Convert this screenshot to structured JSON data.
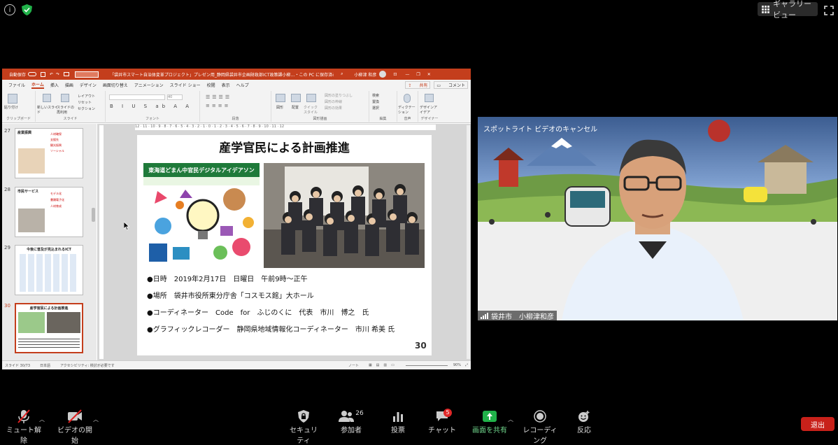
{
  "top": {
    "gallery_label": "ギャラリー ビュー"
  },
  "ppt": {
    "autosave": "自動保存",
    "doc_title": "「袋井市スマート自治体変革プロジェクト」プレゼン用_静岡県袋井市企画財政部ICT政策課小柳…・この PC に保存済み",
    "user": "小柳津 和彦",
    "tabs": [
      "ファイル",
      "ホーム",
      "挿入",
      "描画",
      "デザイン",
      "画面切り替え",
      "アニメーション",
      "スライド ショー",
      "校閲",
      "表示",
      "ヘルプ"
    ],
    "share": "共有",
    "comment": "コメント",
    "groups": [
      "クリップボード",
      "スライド",
      "フォント",
      "段落",
      "図形描画",
      "編集",
      "音声",
      "デザイナー"
    ],
    "buttons": {
      "paste": "貼り付け",
      "new_slide": "新しいスライド",
      "reuse": "スライドの再利用",
      "layout": "レイアウト",
      "reset": "リセット",
      "section": "セクション",
      "shape": "図形",
      "arrange": "配置",
      "quick": "クイックスタイル",
      "fill": "図形の塗りつぶし",
      "outline": "図形の枠線",
      "effect": "図形の効果",
      "find": "検索",
      "replace": "置換",
      "select": "選択",
      "dictation": "ディクテーション",
      "designer": "デザインアイデア"
    },
    "font_size": "40",
    "ruler": "12 · 11 · 10 · 9 · 8 · 7 · 6 · 5 · 4 · 3 · 2 · 1 · 0 · 1 · 2 · 3 · 4 · 5 · 6 · 7 · 8 · 9 · 10 · 11 · 12",
    "thumbnails": [
      {
        "num": "27",
        "title": "産業振興",
        "lines": [
          "人材確保",
          "支援先",
          "観光振興",
          "ソーシャル"
        ]
      },
      {
        "num": "28",
        "title": "市民サービス",
        "lines": [
          "モデル化",
          "書類電子化",
          "人材育成"
        ]
      },
      {
        "num": "29",
        "title": "今後に普及が見込まれるICT",
        "lines": []
      },
      {
        "num": "30",
        "title": "産学官民による計画推進",
        "lines": []
      }
    ],
    "slide": {
      "title": "産学官民による計画推進",
      "poster_banner": "東海道どまん中官民デジタルアイデアソン",
      "info": [
        "●日時　2019年2月17日　日曜日　午前9時～正午",
        "●場所　袋井市役所東分庁舎「コスモス館」大ホール",
        "●コーディネーター　Code　for　ふじのくに　代表　市川　博之　氏",
        "●グラフィックレコーダー　静岡県地域情報化コーディネーター　市川 希美 氏"
      ],
      "number": "30"
    },
    "status": {
      "slide": "スライド 30/73",
      "lang": "日本語",
      "access": "アクセシビリティ: 検討が必要です",
      "notes": "ノート",
      "zoom": "90%"
    }
  },
  "video": {
    "cancel_label": "スポットライト ビデオのキャンセル",
    "name": "袋井市　小柳津和彦"
  },
  "toolbar": {
    "mute": "ミュート解除",
    "video": "ビデオの開始",
    "security": "セキュリティ",
    "participants": "参加者",
    "participants_count": "26",
    "polls": "投票",
    "chat": "チャット",
    "chat_badge": "5",
    "share": "画面を共有",
    "record": "レコーディング",
    "reactions": "反応",
    "leave": "退出"
  },
  "colors": {
    "ppt_accent": "#c43e1c",
    "share_green": "#21b24a",
    "leave_red": "#c8211a"
  }
}
